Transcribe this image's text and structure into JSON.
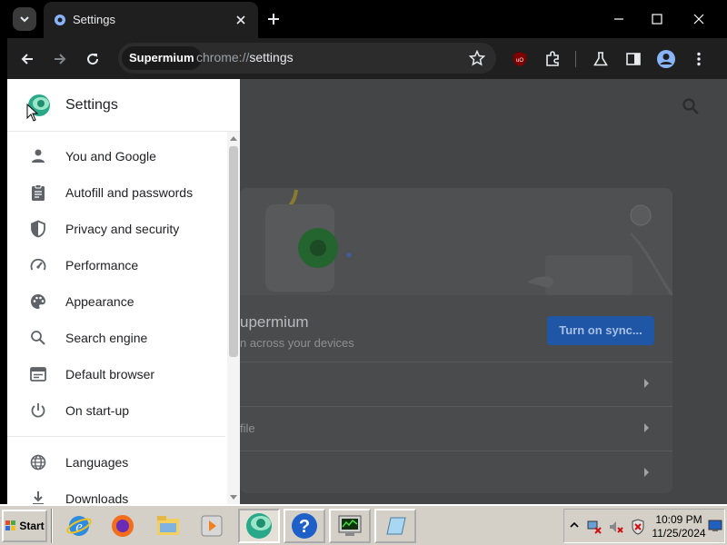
{
  "browser": {
    "tab_title": "Settings",
    "omnibox_chip": "Supermium",
    "url_scheme": "chrome://",
    "url_path": "settings"
  },
  "drawer": {
    "title": "Settings",
    "items": [
      {
        "label": "You and Google",
        "icon": "person-icon"
      },
      {
        "label": "Autofill and passwords",
        "icon": "clipboard-icon"
      },
      {
        "label": "Privacy and security",
        "icon": "shield-icon"
      },
      {
        "label": "Performance",
        "icon": "speedometer-icon"
      },
      {
        "label": "Appearance",
        "icon": "palette-icon"
      },
      {
        "label": "Search engine",
        "icon": "search-icon"
      },
      {
        "label": "Default browser",
        "icon": "browser-window-icon"
      },
      {
        "label": "On start-up",
        "icon": "power-icon"
      },
      {
        "label": "Languages",
        "icon": "globe-icon"
      },
      {
        "label": "Downloads",
        "icon": "download-icon"
      }
    ]
  },
  "main": {
    "card_title": "upermium",
    "card_subtitle": "n across your devices",
    "sync_button": "Turn on sync...",
    "row2_label": "file"
  },
  "taskbar": {
    "start_label": "Start",
    "clock_time": "10:09 PM",
    "clock_date": "11/25/2024"
  },
  "colors": {
    "accent": "#1f56a6",
    "drawer_bg": "#ffffff",
    "scrim": "#444547"
  }
}
